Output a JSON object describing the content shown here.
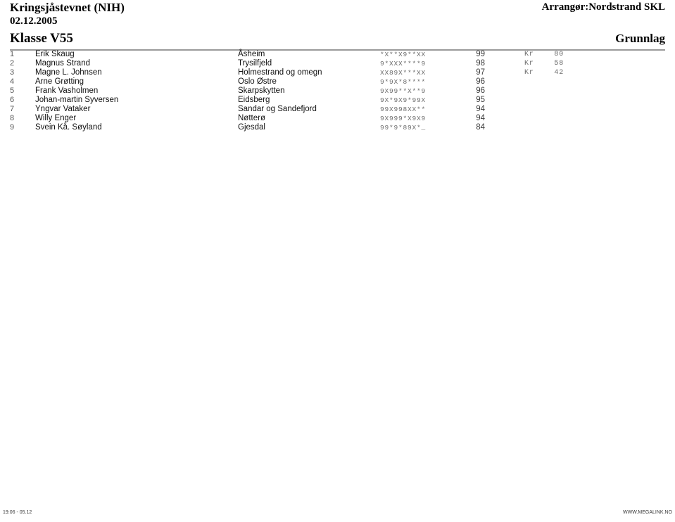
{
  "header": {
    "event_title": "Kringsjåstevnet (NIH)",
    "event_date": "02.12.2005",
    "class_title": "Klasse V55",
    "organizer": "Arrangør:Nordstrand SKL",
    "grunnlag_label": "Grunnlag"
  },
  "results": {
    "rows": [
      {
        "rank": "1",
        "name": "Erik Skaug",
        "club": "Åsheim",
        "series": "*X**X9**XX",
        "total": "99",
        "kr_label": "Kr",
        "kr_value": "80"
      },
      {
        "rank": "2",
        "name": "Magnus Strand",
        "club": "Trysilfjeld",
        "series": "9*XXX****9",
        "total": "98",
        "kr_label": "Kr",
        "kr_value": "58"
      },
      {
        "rank": "3",
        "name": "Magne L. Johnsen",
        "club": "Holmestrand og omegn",
        "series": "XX89X***XX",
        "total": "97",
        "kr_label": "Kr",
        "kr_value": "42"
      },
      {
        "rank": "4",
        "name": "Arne Grøtting",
        "club": "Oslo Østre",
        "series": "9*9X*8****",
        "total": "96",
        "kr_label": "",
        "kr_value": ""
      },
      {
        "rank": "5",
        "name": "Frank Vasholmen",
        "club": "Skarpskytten",
        "series": "9X99**X**9",
        "total": "96",
        "kr_label": "",
        "kr_value": ""
      },
      {
        "rank": "6",
        "name": "Johan-martin Syversen",
        "club": "Eidsberg",
        "series": "9X*9X9*99X",
        "total": "95",
        "kr_label": "",
        "kr_value": ""
      },
      {
        "rank": "7",
        "name": "Yngvar Vataker",
        "club": "Sandar og Sandefjord",
        "series": "99X998XX**",
        "total": "94",
        "kr_label": "",
        "kr_value": ""
      },
      {
        "rank": "8",
        "name": "Willy Enger",
        "club": "Nøtterø",
        "series": "9X999*X9X9",
        "total": "94",
        "kr_label": "",
        "kr_value": ""
      },
      {
        "rank": "9",
        "name": "Svein Kå. Søyland",
        "club": "Gjesdal",
        "series": "99*9*89X*_",
        "total": "84",
        "kr_label": "",
        "kr_value": ""
      }
    ]
  },
  "footer": {
    "timestamp": "19:06 - 05.12",
    "site": "WWW.MEGALINK.NO"
  }
}
